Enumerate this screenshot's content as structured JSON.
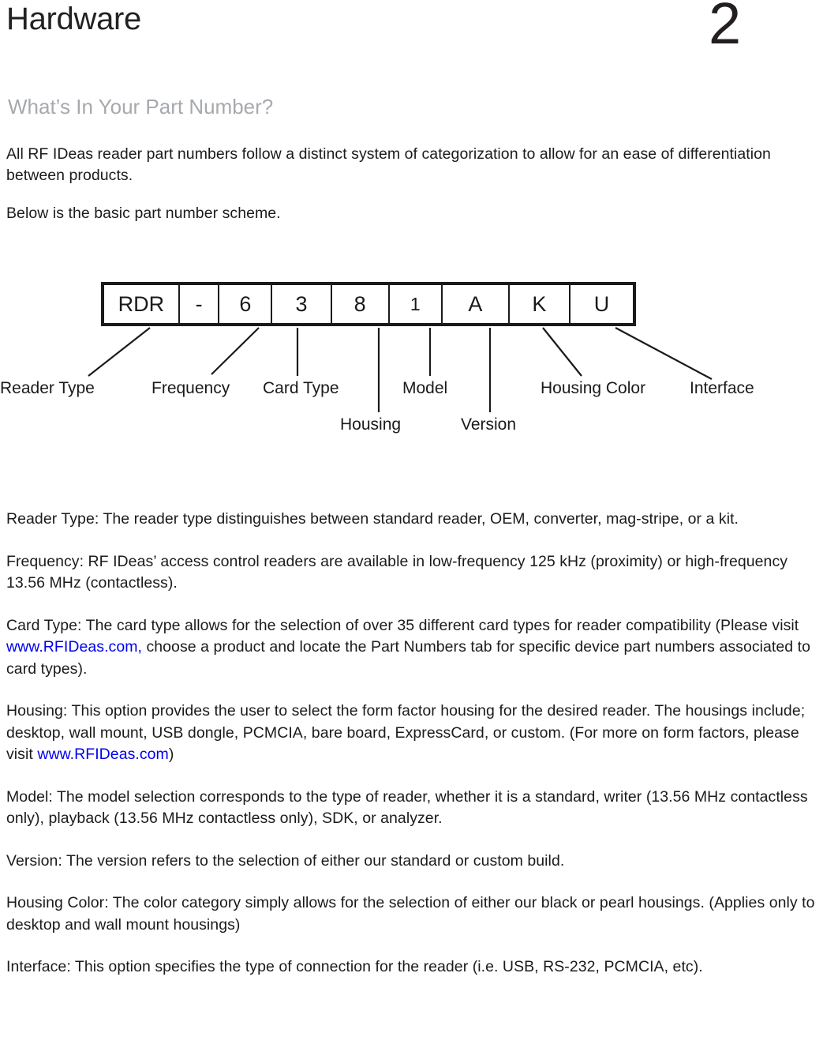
{
  "header": {
    "chapter_title": "Hardware",
    "chapter_number": "2"
  },
  "section": {
    "subtitle": "What’s In Your Part Number?"
  },
  "intro": {
    "paragraph_1": "All RF IDeas reader part numbers follow a distinct system of categorization to allow for an ease of differentiation  between products.",
    "paragraph_2": "Below is the basic part number scheme."
  },
  "diagram": {
    "name": "part-number-scheme",
    "cells": [
      {
        "value": "RDR"
      },
      {
        "value": "-"
      },
      {
        "value": "6"
      },
      {
        "value": "3"
      },
      {
        "value": "8"
      },
      {
        "value": "1"
      },
      {
        "value": "A"
      },
      {
        "value": "K"
      },
      {
        "value": "U"
      }
    ],
    "labels": [
      {
        "text": "Reader Type",
        "row": "upper"
      },
      {
        "text": "Frequency",
        "row": "upper"
      },
      {
        "text": "Card Type",
        "row": "upper"
      },
      {
        "text": "Model",
        "row": "upper"
      },
      {
        "text": "Housing Color",
        "row": "upper"
      },
      {
        "text": "Interface",
        "row": "upper"
      },
      {
        "text": "Housing",
        "row": "lower"
      },
      {
        "text": "Version",
        "row": "lower"
      }
    ]
  },
  "definitions": {
    "reader_type": {
      "term": "Reader Type: ",
      "body": "The reader type distinguishes between standard reader, OEM, converter, mag-stripe, or a kit."
    },
    "frequency": {
      "term": "Frequency: ",
      "body": "RF IDeas’ access control  readers are available in low-frequency 125 kHz (proximity) or high-frequency 13.56 MHz (contactless)."
    },
    "card_type": {
      "term": "Card Type: ",
      "body_before_link": "The card type allows for the selection of over 35 different card types for reader compatibility (Please visit ",
      "link_text": "www.RFIDeas.com,",
      "body_after_link": " choose a product  and locate the Part Numbers tab for specific device part numbers associated to card types)."
    },
    "housing": {
      "term": "Housing: ",
      "body_before_link": "This option provides the user to select the form factor housing for the desired reader. The housings include; desktop, wall mount,  USB dongle,  PCMCIA,  bare  board,  ExpressCard,  or custom. (For more on form factors, please visit ",
      "link_text": "www.RFIDeas.com",
      "body_after_link": ")"
    },
    "model": {
      "term": "Model: ",
      "body": "The model selection corresponds to the type of reader, whether  it is a standard,  writer (13.56 MHz contactless only), playback (13.56 MHz contactless  only),  SDK, or analyzer."
    },
    "version": {
      "term": "Version: ",
      "body": "The version refers to the selection of either our standard or custom build."
    },
    "housing_color": {
      "term": "Housing Color: ",
      "body": "The color category simply allows for the selection of either our black or pearl housings. (Applies only to desktop and wall mount housings)"
    },
    "interface": {
      "term": "Interface: ",
      "body": "This option specifies the type of connection for the reader  (i.e.  USB, RS-232,  PCMCIA,  etc)."
    }
  },
  "colors": {
    "text": "#1b1b1b",
    "subtitle_gray": "#a6a9ad",
    "link_blue": "#0000f0",
    "diagram_stroke": "#1a1a1a"
  }
}
